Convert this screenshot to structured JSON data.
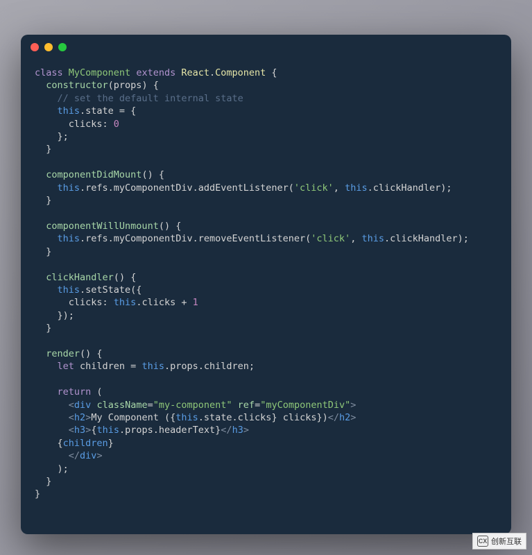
{
  "window": {
    "controls": {
      "close": "close",
      "minimize": "minimize",
      "maximize": "maximize"
    }
  },
  "code": {
    "tokens": [
      {
        "t": "class ",
        "c": "tok-keyword"
      },
      {
        "t": "MyComponent ",
        "c": "tok-class"
      },
      {
        "t": "extends ",
        "c": "tok-keyword"
      },
      {
        "t": "React",
        "c": "tok-type"
      },
      {
        "t": ".",
        "c": "tok-punct"
      },
      {
        "t": "Component ",
        "c": "tok-type"
      },
      {
        "t": "{\n  ",
        "c": "tok-punct"
      },
      {
        "t": "constructor",
        "c": "tok-property"
      },
      {
        "t": "(props) {\n    ",
        "c": "tok-punct"
      },
      {
        "t": "// set the default internal state",
        "c": "tok-comment"
      },
      {
        "t": "\n    ",
        "c": "tok-punct"
      },
      {
        "t": "this",
        "c": "tok-this"
      },
      {
        "t": ".state = {\n      clicks: ",
        "c": "tok-punct"
      },
      {
        "t": "0",
        "c": "tok-number"
      },
      {
        "t": "\n    };\n  }\n\n  ",
        "c": "tok-punct"
      },
      {
        "t": "componentDidMount",
        "c": "tok-property"
      },
      {
        "t": "() {\n    ",
        "c": "tok-punct"
      },
      {
        "t": "this",
        "c": "tok-this"
      },
      {
        "t": ".refs.myComponentDiv.addEventListener(",
        "c": "tok-punct"
      },
      {
        "t": "'click'",
        "c": "tok-string"
      },
      {
        "t": ", ",
        "c": "tok-punct"
      },
      {
        "t": "this",
        "c": "tok-this"
      },
      {
        "t": ".clickHandler);\n  }\n\n  ",
        "c": "tok-punct"
      },
      {
        "t": "componentWillUnmount",
        "c": "tok-property"
      },
      {
        "t": "() {\n    ",
        "c": "tok-punct"
      },
      {
        "t": "this",
        "c": "tok-this"
      },
      {
        "t": ".refs.myComponentDiv.removeEventListener(",
        "c": "tok-punct"
      },
      {
        "t": "'click'",
        "c": "tok-string"
      },
      {
        "t": ", ",
        "c": "tok-punct"
      },
      {
        "t": "this",
        "c": "tok-this"
      },
      {
        "t": ".clickHandler);\n  }\n\n  ",
        "c": "tok-punct"
      },
      {
        "t": "clickHandler",
        "c": "tok-property"
      },
      {
        "t": "() {\n    ",
        "c": "tok-punct"
      },
      {
        "t": "this",
        "c": "tok-this"
      },
      {
        "t": ".setState({\n      clicks: ",
        "c": "tok-punct"
      },
      {
        "t": "this",
        "c": "tok-this"
      },
      {
        "t": ".clicks + ",
        "c": "tok-punct"
      },
      {
        "t": "1",
        "c": "tok-number"
      },
      {
        "t": "\n    });\n  }\n\n  ",
        "c": "tok-punct"
      },
      {
        "t": "render",
        "c": "tok-property"
      },
      {
        "t": "() {\n    ",
        "c": "tok-punct"
      },
      {
        "t": "let ",
        "c": "tok-keyword"
      },
      {
        "t": "children = ",
        "c": "tok-punct"
      },
      {
        "t": "this",
        "c": "tok-this"
      },
      {
        "t": ".props.children;\n\n    ",
        "c": "tok-punct"
      },
      {
        "t": "return ",
        "c": "tok-keyword"
      },
      {
        "t": "(\n      ",
        "c": "tok-punct"
      },
      {
        "t": "<",
        "c": "tok-tagpunct"
      },
      {
        "t": "div ",
        "c": "tok-tag"
      },
      {
        "t": "className",
        "c": "tok-attr"
      },
      {
        "t": "=",
        "c": "tok-punct"
      },
      {
        "t": "\"my-component\"",
        "c": "tok-attrval"
      },
      {
        "t": " ",
        "c": "tok-punct"
      },
      {
        "t": "ref",
        "c": "tok-attr"
      },
      {
        "t": "=",
        "c": "tok-punct"
      },
      {
        "t": "\"myComponentDiv\"",
        "c": "tok-attrval"
      },
      {
        "t": ">",
        "c": "tok-tagpunct"
      },
      {
        "t": "\n      ",
        "c": "tok-punct"
      },
      {
        "t": "<",
        "c": "tok-tagpunct"
      },
      {
        "t": "h2",
        "c": "tok-tag"
      },
      {
        "t": ">",
        "c": "tok-tagpunct"
      },
      {
        "t": "My Component ({",
        "c": "tok-punct"
      },
      {
        "t": "this",
        "c": "tok-this"
      },
      {
        "t": ".state.clicks",
        "c": "tok-punct"
      },
      {
        "t": "} clicks})",
        "c": "tok-punct"
      },
      {
        "t": "</",
        "c": "tok-tagpunct"
      },
      {
        "t": "h2",
        "c": "tok-tag"
      },
      {
        "t": ">",
        "c": "tok-tagpunct"
      },
      {
        "t": "\n      ",
        "c": "tok-punct"
      },
      {
        "t": "<",
        "c": "tok-tagpunct"
      },
      {
        "t": "h3",
        "c": "tok-tag"
      },
      {
        "t": ">",
        "c": "tok-tagpunct"
      },
      {
        "t": "{",
        "c": "tok-punct"
      },
      {
        "t": "this",
        "c": "tok-this"
      },
      {
        "t": ".props.headerText",
        "c": "tok-punct"
      },
      {
        "t": "}",
        "c": "tok-punct"
      },
      {
        "t": "</",
        "c": "tok-tagpunct"
      },
      {
        "t": "h3",
        "c": "tok-tag"
      },
      {
        "t": ">",
        "c": "tok-tagpunct"
      },
      {
        "t": "\n    {",
        "c": "tok-punct"
      },
      {
        "t": "children",
        "c": "tok-tag"
      },
      {
        "t": "}\n      ",
        "c": "tok-punct"
      },
      {
        "t": "</",
        "c": "tok-tagpunct"
      },
      {
        "t": "div",
        "c": "tok-tag"
      },
      {
        "t": ">",
        "c": "tok-tagpunct"
      },
      {
        "t": "\n    );\n  }\n}",
        "c": "tok-punct"
      }
    ]
  },
  "watermark": {
    "text": "创新互联",
    "icon": "CX"
  }
}
